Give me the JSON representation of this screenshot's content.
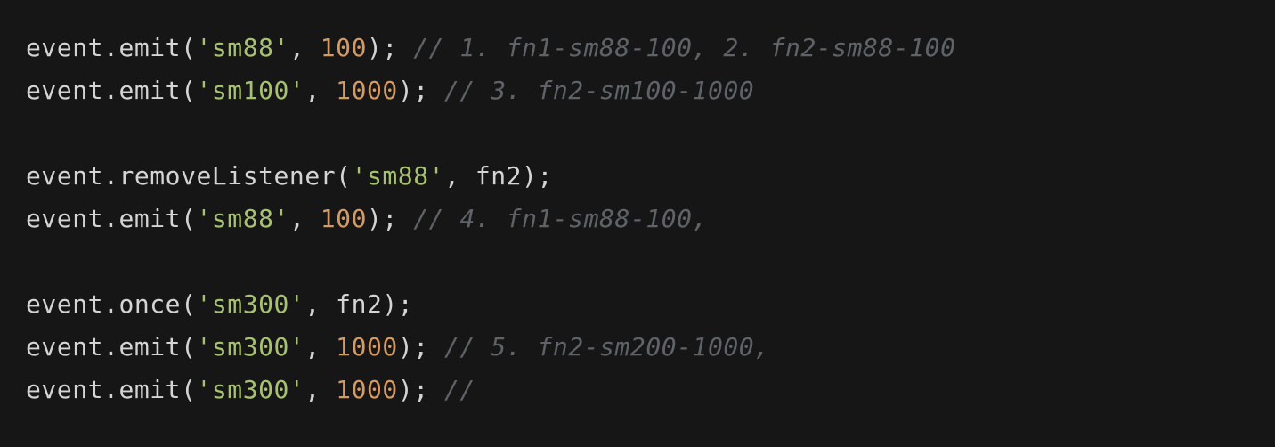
{
  "code_lines": [
    {
      "tokens": [
        {
          "type": "plain",
          "text": "event.emit("
        },
        {
          "type": "string",
          "text": "'sm88'"
        },
        {
          "type": "plain",
          "text": ", "
        },
        {
          "type": "number",
          "text": "100"
        },
        {
          "type": "plain",
          "text": "); "
        },
        {
          "type": "comment",
          "text": "// 1. fn1-sm88-100, 2. fn2-sm88-100"
        }
      ]
    },
    {
      "tokens": [
        {
          "type": "plain",
          "text": "event.emit("
        },
        {
          "type": "string",
          "text": "'sm100'"
        },
        {
          "type": "plain",
          "text": ", "
        },
        {
          "type": "number",
          "text": "1000"
        },
        {
          "type": "plain",
          "text": "); "
        },
        {
          "type": "comment",
          "text": "// 3. fn2-sm100-1000"
        }
      ]
    },
    {
      "tokens": []
    },
    {
      "tokens": [
        {
          "type": "plain",
          "text": "event.removeListener("
        },
        {
          "type": "string",
          "text": "'sm88'"
        },
        {
          "type": "plain",
          "text": ", fn2);"
        }
      ]
    },
    {
      "tokens": [
        {
          "type": "plain",
          "text": "event.emit("
        },
        {
          "type": "string",
          "text": "'sm88'"
        },
        {
          "type": "plain",
          "text": ", "
        },
        {
          "type": "number",
          "text": "100"
        },
        {
          "type": "plain",
          "text": "); "
        },
        {
          "type": "comment",
          "text": "// 4. fn1-sm88-100,"
        }
      ]
    },
    {
      "tokens": []
    },
    {
      "tokens": [
        {
          "type": "plain",
          "text": "event.once("
        },
        {
          "type": "string",
          "text": "'sm300'"
        },
        {
          "type": "plain",
          "text": ", fn2);"
        }
      ]
    },
    {
      "tokens": [
        {
          "type": "plain",
          "text": "event.emit("
        },
        {
          "type": "string",
          "text": "'sm300'"
        },
        {
          "type": "plain",
          "text": ", "
        },
        {
          "type": "number",
          "text": "1000"
        },
        {
          "type": "plain",
          "text": "); "
        },
        {
          "type": "comment",
          "text": "// 5. fn2-sm200-1000,"
        }
      ]
    },
    {
      "tokens": [
        {
          "type": "plain",
          "text": "event.emit("
        },
        {
          "type": "string",
          "text": "'sm300'"
        },
        {
          "type": "plain",
          "text": ", "
        },
        {
          "type": "number",
          "text": "1000"
        },
        {
          "type": "plain",
          "text": "); "
        },
        {
          "type": "comment",
          "text": "//"
        }
      ]
    }
  ],
  "colors": {
    "background": "#161616",
    "plain": "#d4d4d4",
    "string": "#a7c26f",
    "number": "#d49a63",
    "comment": "#5f6368"
  }
}
